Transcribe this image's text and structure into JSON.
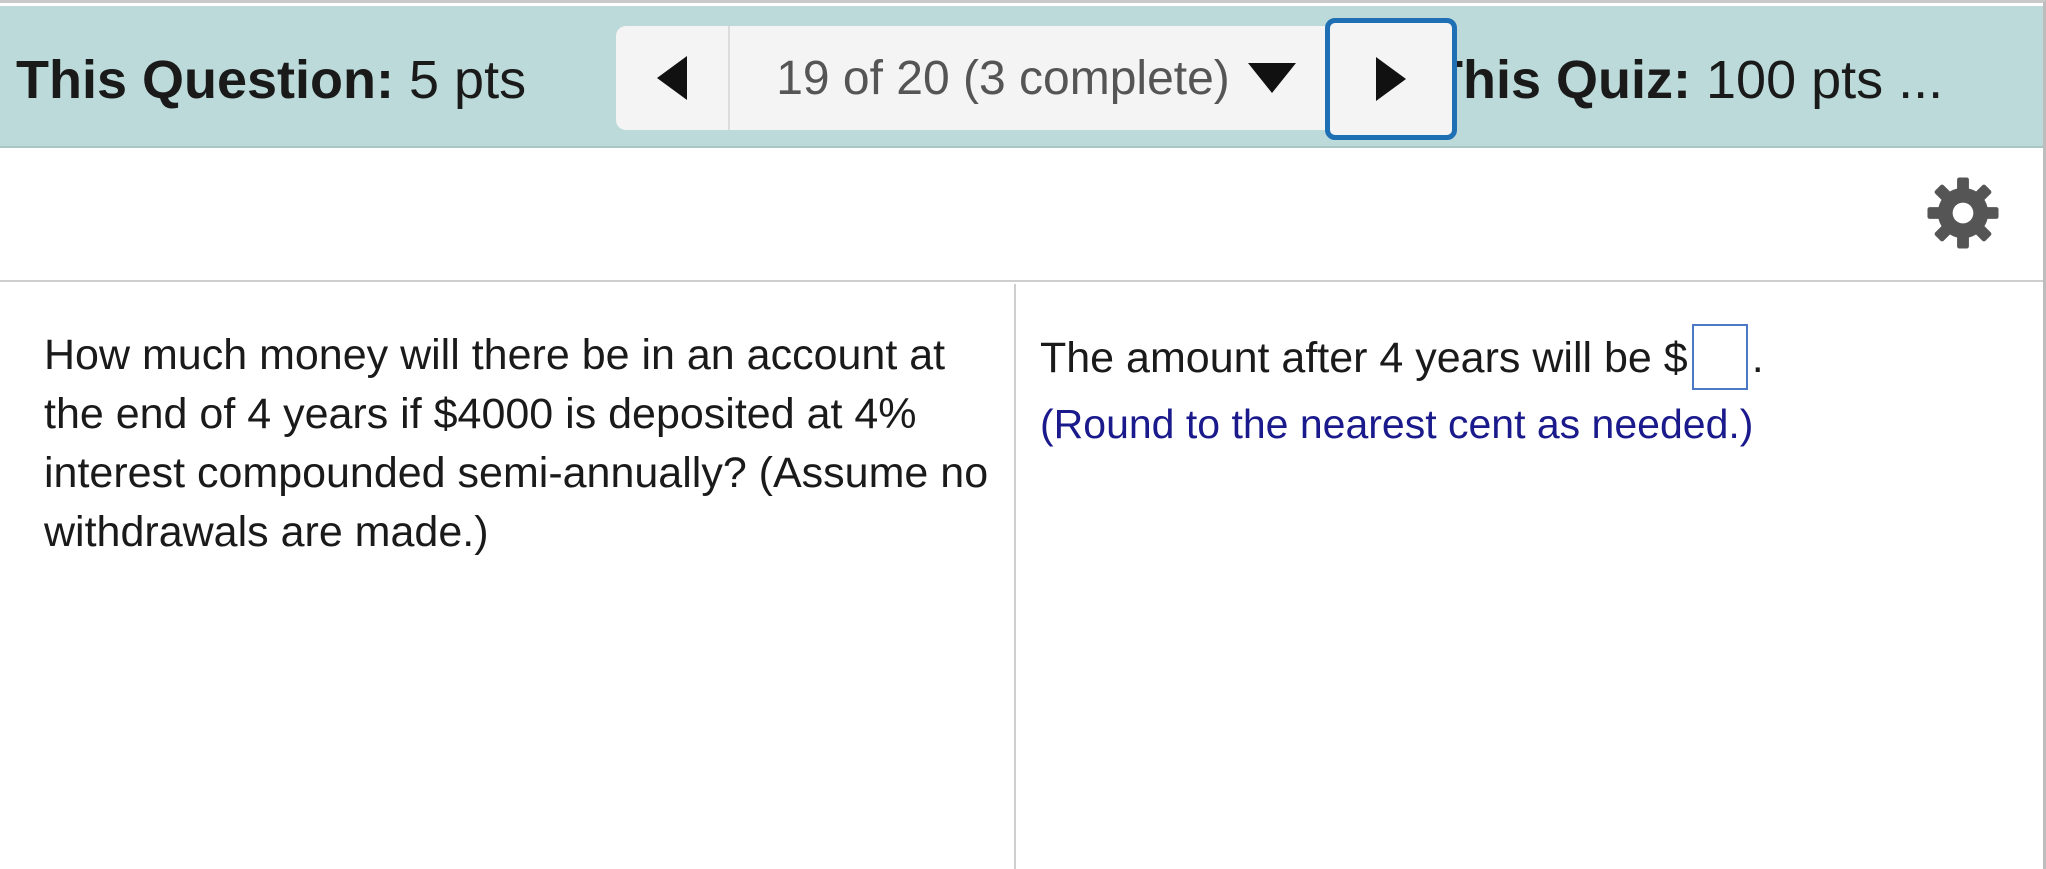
{
  "header": {
    "question_label": "This Question:",
    "question_points": "5 pts",
    "navigator": {
      "position_text": "19 of 20 (3 complete)"
    },
    "quiz_label": "This Quiz:",
    "quiz_points": "100 pts ..."
  },
  "toolbar": {
    "settings_icon": "gear-icon"
  },
  "question": {
    "text": "How much money will there be in an account at the end of 4 years if $4000 is deposited at 4% interest compounded semi-annually? (Assume no withdrawals are made.)"
  },
  "answer": {
    "prefix": "The amount after 4 years will be $",
    "suffix": ".",
    "input_value": "",
    "hint": "(Round to the nearest cent as needed.)"
  },
  "colors": {
    "header_bg": "#bbdad9",
    "focus_border": "#1f6fb5",
    "hint_text": "#1a1a8c"
  }
}
